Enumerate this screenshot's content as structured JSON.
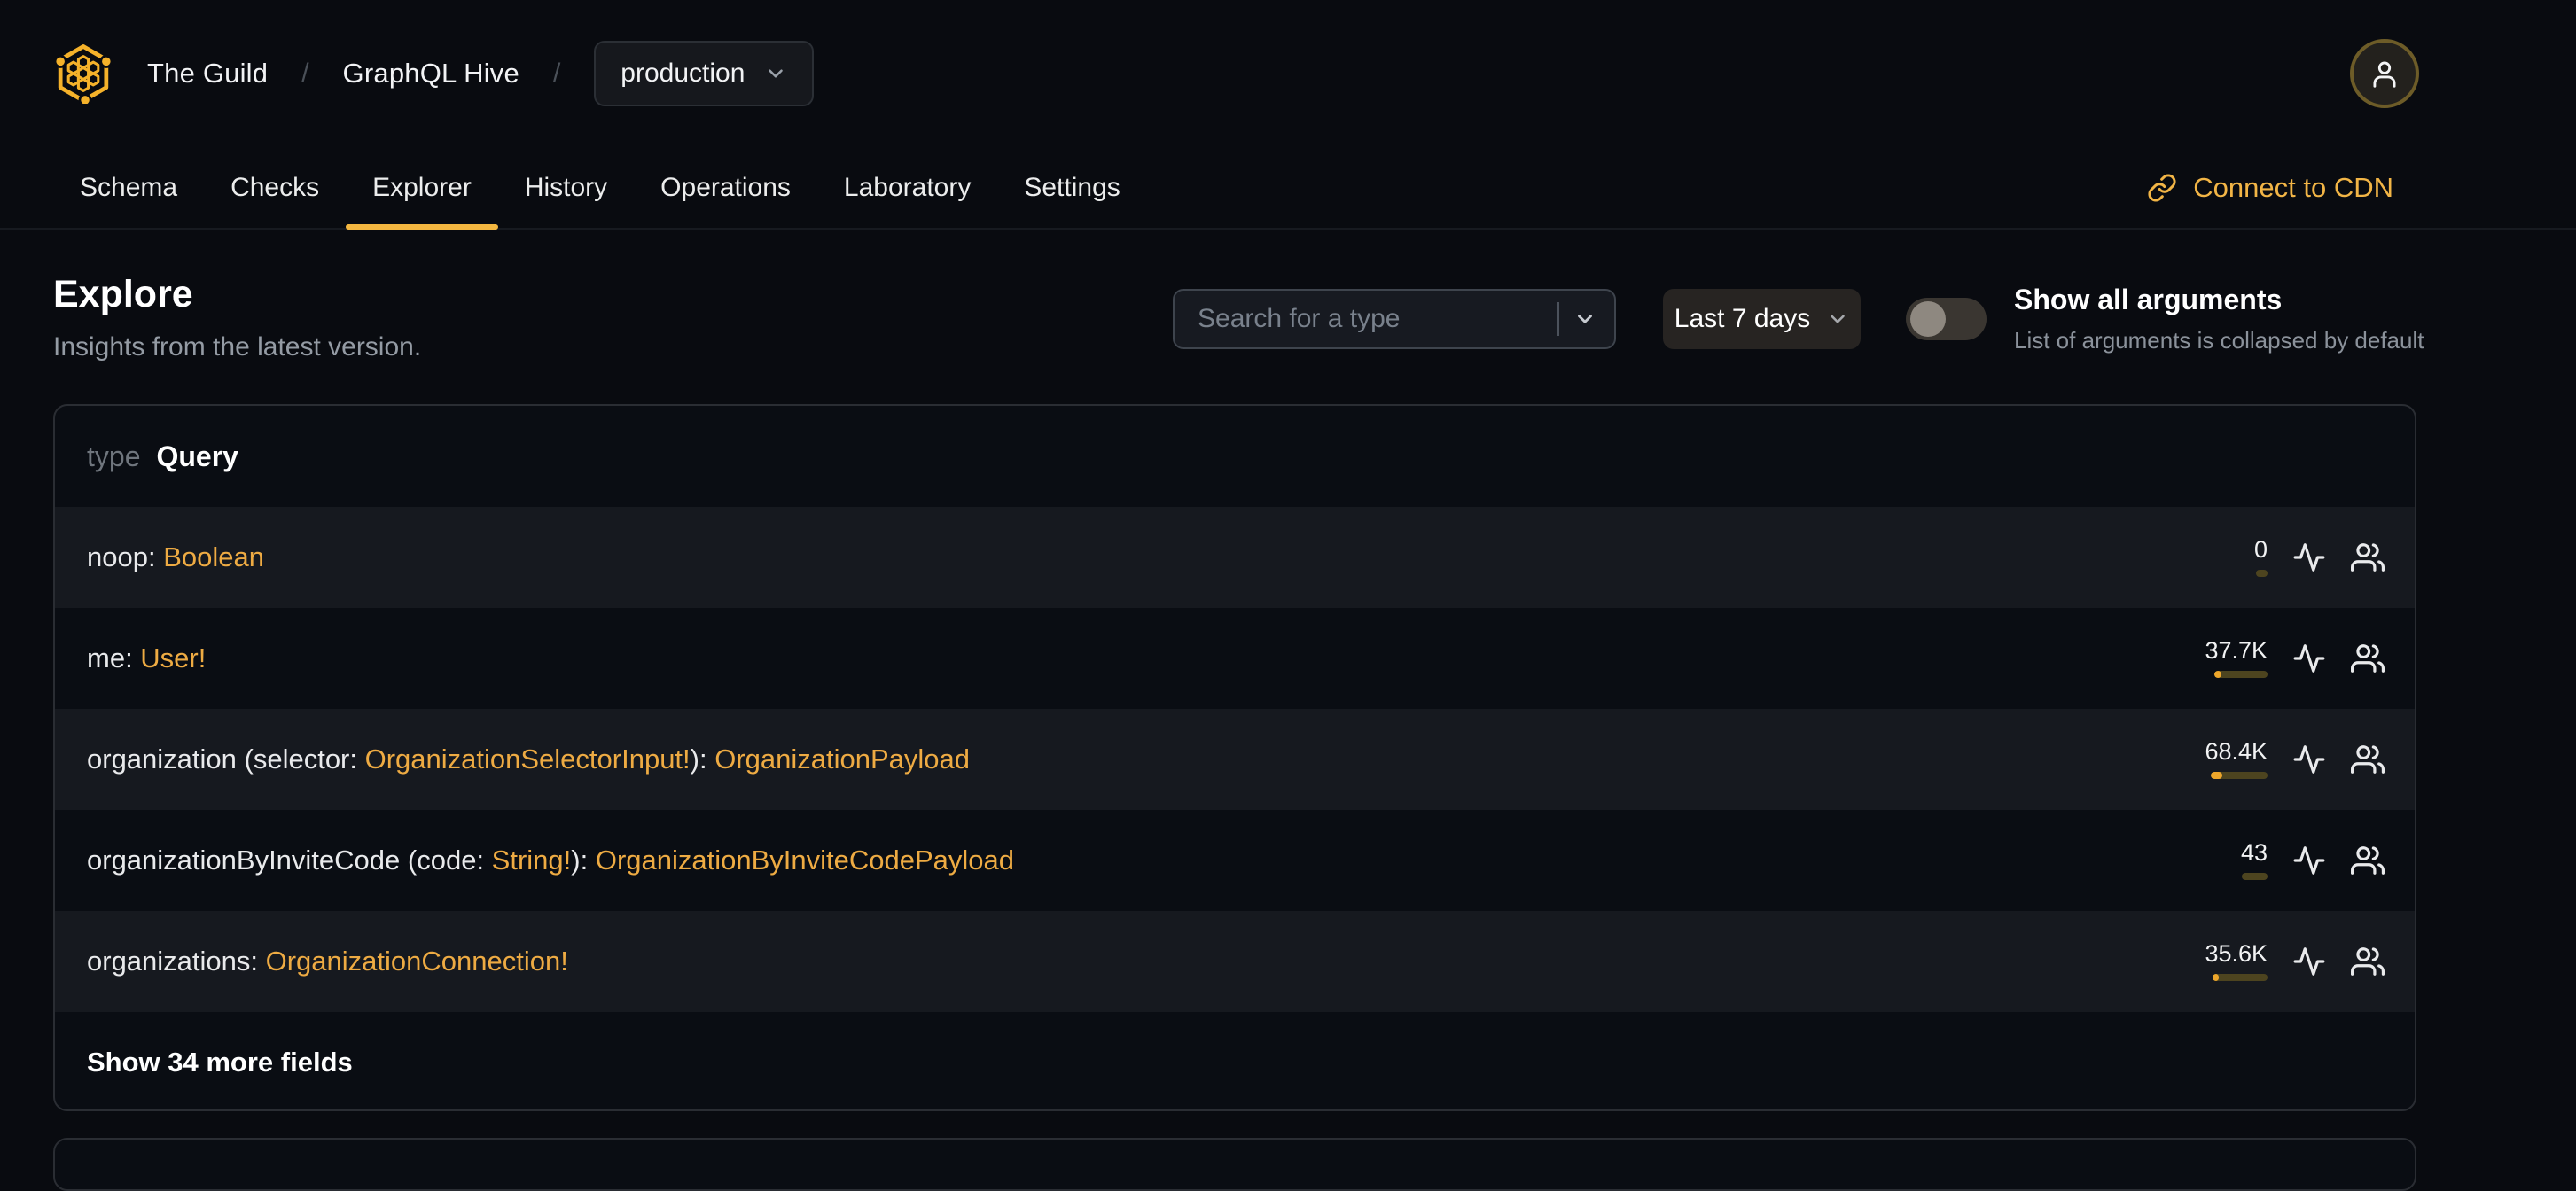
{
  "header": {
    "logo_icon": "hive-honeycomb-icon",
    "breadcrumb": {
      "org": "The Guild",
      "separator": "/",
      "project": "GraphQL Hive",
      "target": {
        "value": "production",
        "icon": "chevron-down-icon"
      }
    },
    "avatar_icon": "user-icon",
    "tabs": [
      {
        "label": "Schema",
        "active": false
      },
      {
        "label": "Checks",
        "active": false
      },
      {
        "label": "Explorer",
        "active": true
      },
      {
        "label": "History",
        "active": false
      },
      {
        "label": "Operations",
        "active": false
      },
      {
        "label": "Laboratory",
        "active": false
      },
      {
        "label": "Settings",
        "active": false
      }
    ],
    "connect_cdn": {
      "label": "Connect to CDN",
      "icon": "link-icon"
    }
  },
  "page": {
    "title": "Explore",
    "subtitle": "Insights from the latest version."
  },
  "controls": {
    "search": {
      "placeholder": "Search for a type",
      "icon": "chevron-down-icon"
    },
    "period": {
      "value": "Last 7 days",
      "icon": "chevron-down-icon"
    },
    "show_all_arguments": {
      "label": "Show all arguments",
      "description": "List of arguments is collapsed by default",
      "enabled": false
    }
  },
  "type_card": {
    "kind_keyword": "type",
    "type_name": "Query",
    "row_icons": [
      "activity-icon",
      "users-icon"
    ],
    "fields": [
      {
        "segments": [
          {
            "text": "noop: ",
            "kind": "plain"
          },
          {
            "text": "Boolean",
            "kind": "type"
          }
        ],
        "value": "0",
        "bar": {
          "track_pct": 21,
          "fill_pct": 0
        }
      },
      {
        "segments": [
          {
            "text": "me: ",
            "kind": "plain"
          },
          {
            "text": "User!",
            "kind": "type"
          }
        ],
        "value": "37.7K",
        "bar": {
          "track_pct": 94,
          "fill_pct": 14
        }
      },
      {
        "segments": [
          {
            "text": "organization (selector: ",
            "kind": "plain"
          },
          {
            "text": "OrganizationSelectorInput!",
            "kind": "type"
          },
          {
            "text": "): ",
            "kind": "plain"
          },
          {
            "text": "OrganizationPayload",
            "kind": "type"
          }
        ],
        "value": "68.4K",
        "bar": {
          "track_pct": 100,
          "fill_pct": 20
        }
      },
      {
        "segments": [
          {
            "text": "organizationByInviteCode (code: ",
            "kind": "plain"
          },
          {
            "text": "String!",
            "kind": "type"
          },
          {
            "text": "): ",
            "kind": "plain"
          },
          {
            "text": "OrganizationByInviteCodePayload",
            "kind": "type"
          }
        ],
        "value": "43",
        "bar": {
          "track_pct": 46,
          "fill_pct": 0
        }
      },
      {
        "segments": [
          {
            "text": "organizations: ",
            "kind": "plain"
          },
          {
            "text": "OrganizationConnection!",
            "kind": "type"
          }
        ],
        "value": "35.6K",
        "bar": {
          "track_pct": 97,
          "fill_pct": 12
        }
      }
    ],
    "show_more_label": "Show 34 more fields"
  },
  "theme": {
    "accent": "#f4b740",
    "type_link_color": "#eeab43",
    "bar_fill": "#eda62b",
    "bar_track": "#4d441f",
    "avatar_ring": "#6d5c28",
    "page_background": "#090b10"
  }
}
